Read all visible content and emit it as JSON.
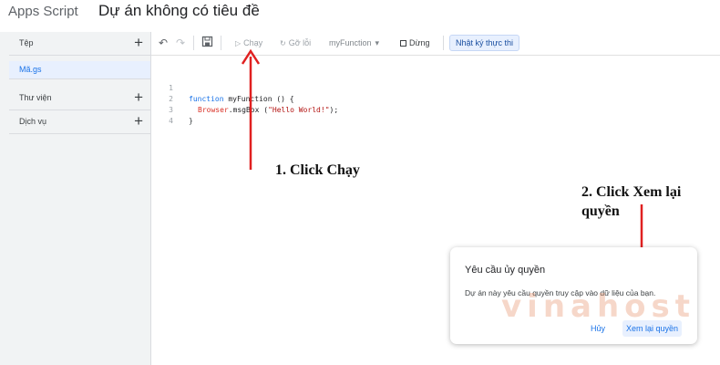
{
  "header": {
    "app_name": "Apps Script",
    "project_title": "Dự án không có tiêu đề"
  },
  "toolbar": {
    "undo_icon": "undo-icon",
    "redo_icon": "redo-icon",
    "save_icon": "save-icon",
    "run_label": "Chạy",
    "debug_label": "Gỡ lỗi",
    "function_select": "myFunction",
    "stop_label": "Dừng",
    "execution_log_label": "Nhật ký thực thi"
  },
  "sidebar": {
    "files_label": "Tệp",
    "file_name": "Mã.gs",
    "libraries_label": "Thư viện",
    "services_label": "Dịch vụ"
  },
  "editor": {
    "line_numbers": [
      "1",
      "2",
      "3",
      "4"
    ],
    "code": {
      "line1_keyword": "function",
      "line1_rest": " myFunction () {",
      "line2_object": "Browser",
      "line2_method": ".msgBox (",
      "line2_string": "\"Hello World!\"",
      "line2_end": ");",
      "line3": "}"
    }
  },
  "annotations": {
    "step1": "1. Click Chạy",
    "step2_line1": "2. Click Xem lại",
    "step2_line2": "quyền"
  },
  "dialog": {
    "title": "Yêu cầu ủy quyền",
    "body": "Dự án này yêu cầu quyền truy cập vào dữ liệu của bạn.",
    "cancel_label": "Hủy",
    "review_label": "Xem lại quyền"
  },
  "watermark": {
    "text": "vinahost"
  },
  "colors": {
    "arrow": "#e02020",
    "accent": "#1a73e8"
  }
}
